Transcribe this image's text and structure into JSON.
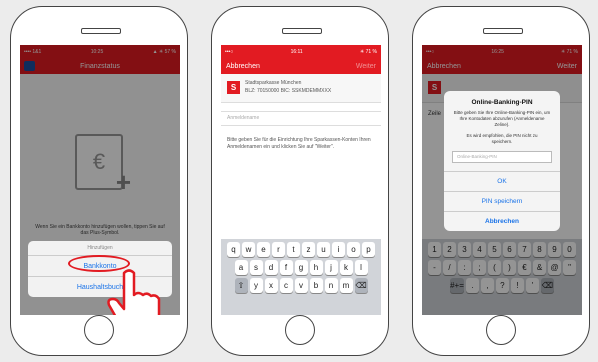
{
  "screen1": {
    "status_left": "•••• 1&1  ",
    "status_time": "10:25",
    "status_right": "▲ ✳ 57 %",
    "nav_title": "Finanzstatus",
    "empty_text": "Wenn Sie ein Bankkonto hinzufügen wollen, tippen Sie auf das Plus-Symbol.",
    "sheet_title": "Hinzufügen",
    "sheet_option1": "Bankkonto",
    "sheet_option2": "Haushaltsbuch"
  },
  "screen2": {
    "status_time": "16:11",
    "status_right": "✳ 71 %",
    "nav_left": "Abbrechen",
    "nav_right": "Weiter",
    "bank_name": "Stadtsparkasse München",
    "bank_detail": "BLZ: 70150000   BIC: SSKMDEMMXXX",
    "input_placeholder": "Anmeldename",
    "help_text": "Bitte geben Sie für die Einrichtung Ihre Sparkassen-Konten Ihren Anmeldenamen ein und klicken Sie auf \"Weiter\".",
    "keys_row1": [
      "q",
      "w",
      "e",
      "r",
      "t",
      "z",
      "u",
      "i",
      "o",
      "p"
    ],
    "keys_row2": [
      "a",
      "s",
      "d",
      "f",
      "g",
      "h",
      "j",
      "k",
      "l"
    ],
    "keys_row3": [
      "⇧",
      "y",
      "x",
      "c",
      "v",
      "b",
      "n",
      "m",
      "⌫"
    ]
  },
  "screen3": {
    "status_time": "16:25",
    "status_right": "✳ 71 %",
    "nav_left": "Abbrechen",
    "nav_right": "Weiter",
    "bg_label": "Zeile",
    "dialog_title": "Online-Banking-PIN",
    "dialog_text1": "Bitte geben Sie Ihre Online-Banking-PIN ein, um Ihre Kontodaten abzurufen (Anmeldename Zeline).",
    "dialog_text2": "Es wird empfohlen, die PIN nicht zu speichern.",
    "pin_placeholder": "Online-Banking-PIN",
    "ok_label": "OK",
    "save_label": "PIN speichern",
    "cancel_label": "Abbrechen",
    "keys_row1": [
      "1",
      "2",
      "3",
      "4",
      "5",
      "6",
      "7",
      "8",
      "9",
      "0"
    ],
    "keys_row2": [
      "-",
      "/",
      ":",
      ";",
      "(",
      ")",
      "€",
      "&",
      "@",
      "\""
    ],
    "keys_row3": [
      "#+=",
      ".",
      ",",
      "?",
      "!",
      "'",
      "⌫"
    ]
  },
  "colors": {
    "brand_red": "#e21b22",
    "ios_blue": "#1a73e8"
  }
}
